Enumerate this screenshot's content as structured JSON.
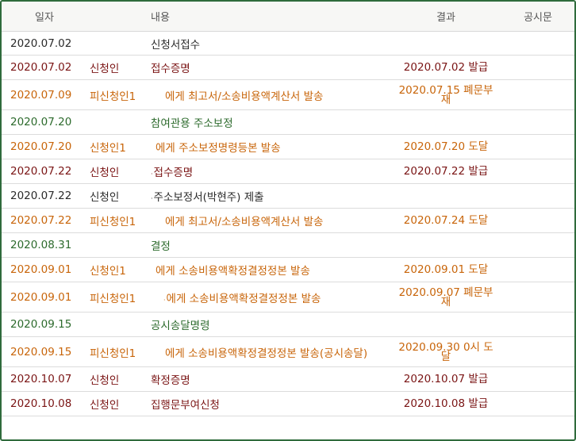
{
  "headers": {
    "date": "일자",
    "content": "내용",
    "result": "결과",
    "notice": "공시문"
  },
  "colors": {
    "black": "#2a2a2a",
    "red": "#7a1414",
    "orange": "#c8650a",
    "green": "#2c6a2c",
    "border": "#2f6b3c"
  },
  "rows": [
    {
      "date": "2020.07.02",
      "party": "",
      "content": "신청서접수",
      "result": "",
      "color": "black",
      "h": 30,
      "indent": 0
    },
    {
      "date": "2020.07.02",
      "party": "신청인",
      "content": "접수증명",
      "result": "2020.07.02 발급",
      "color": "red",
      "h": 31,
      "indent": 0
    },
    {
      "date": "2020.07.09",
      "party": "피신청인1",
      "content": "에게 최고서/소송비용액계산서 발송",
      "result": "2020.07.15 폐문부재",
      "color": "orange",
      "h": 38,
      "indent": 18
    },
    {
      "date": "2020.07.20",
      "party": "",
      "content": "참여관용 주소보정",
      "result": "",
      "color": "green",
      "h": 31,
      "indent": 0
    },
    {
      "date": "2020.07.20",
      "party": "신청인1",
      "content": "에게 주소보정명령등본 발송",
      "result": "2020.07.20 도달",
      "color": "orange",
      "h": 31,
      "indent": 6
    },
    {
      "date": "2020.07.22",
      "party": "신청인",
      "content": "접수증명",
      "result": "2020.07.22 발급",
      "color": "red",
      "h": 31,
      "indent": 0,
      "dot": true
    },
    {
      "date": "2020.07.22",
      "party": "신청인",
      "content": "주소보정서(박현주) 제출",
      "result": "",
      "color": "black",
      "h": 31,
      "indent": 0,
      "dot": true
    },
    {
      "date": "2020.07.22",
      "party": "피신청인1",
      "content": "에게 최고서/소송비용액계산서 발송",
      "result": "2020.07.24 도달",
      "color": "orange",
      "h": 31,
      "indent": 18
    },
    {
      "date": "2020.08.31",
      "party": "",
      "content": "결정",
      "result": "",
      "color": "green",
      "h": 31,
      "indent": 0
    },
    {
      "date": "2020.09.01",
      "party": "신청인1",
      "content": "에게 소송비용액확정결정정본 발송",
      "result": "2020.09.01 도달",
      "color": "orange",
      "h": 31,
      "indent": 6
    },
    {
      "date": "2020.09.01",
      "party": "피신청인1",
      "content": "에게 소송비용액확정결정정본 발송",
      "result": "2020.09.07 폐문부재",
      "color": "orange",
      "h": 38,
      "indent": 16,
      "dot": true
    },
    {
      "date": "2020.09.15",
      "party": "",
      "content": "공시송달명령",
      "result": "",
      "color": "green",
      "h": 31,
      "indent": 0
    },
    {
      "date": "2020.09.15",
      "party": "피신청인1",
      "content": "에게 소송비용액확정결정정본 발송(공시송달)",
      "result": "2020.09.30 0시 도달",
      "color": "orange",
      "h": 38,
      "indent": 18
    },
    {
      "date": "2020.10.07",
      "party": "신청인",
      "content": "확정증명",
      "result": "2020.10.07 발급",
      "color": "red",
      "h": 31,
      "indent": 0
    },
    {
      "date": "2020.10.08",
      "party": "신청인",
      "content": "집행문부여신청",
      "result": "2020.10.08 발급",
      "color": "red",
      "h": 31,
      "indent": 0
    }
  ]
}
